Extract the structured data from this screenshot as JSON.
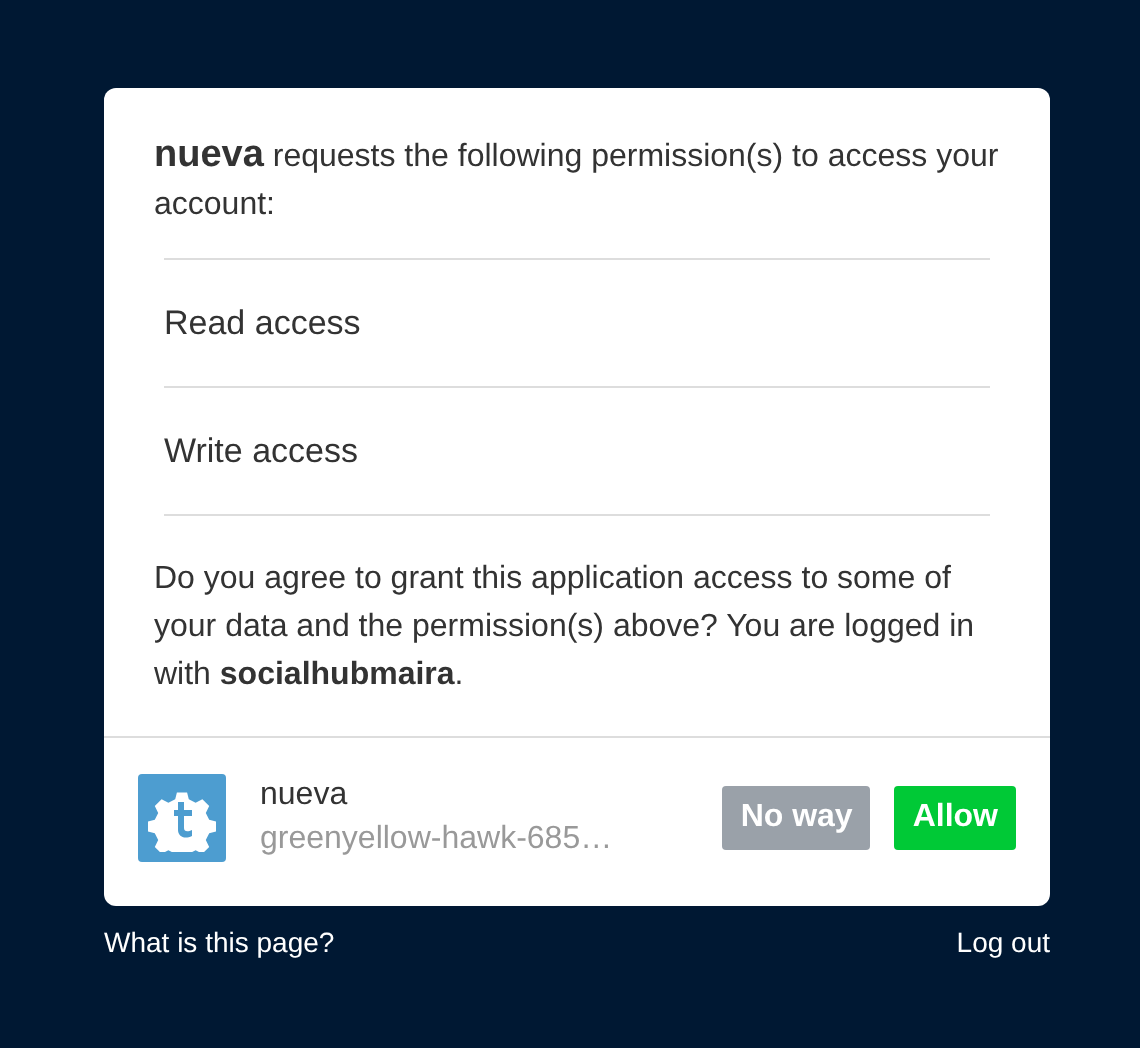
{
  "request": "**nueva** requests the following permission(s) to access your account:",
  "permissions": [
    "Read access",
    "Write access"
  ],
  "question": "Do you agree to grant this application access to some of your data and the permission(s) above? You are logged in with **socialhubmaira**.",
  "app": {
    "name": "nueva",
    "id": "greenyellow-hawk-685…"
  },
  "buttons": [
    {
      "kind": "deny",
      "label": "No way"
    },
    {
      "kind": "allow",
      "label": "Allow"
    }
  ],
  "footer": {
    "help_link": "What is this page?",
    "logout_link": "Log out"
  }
}
